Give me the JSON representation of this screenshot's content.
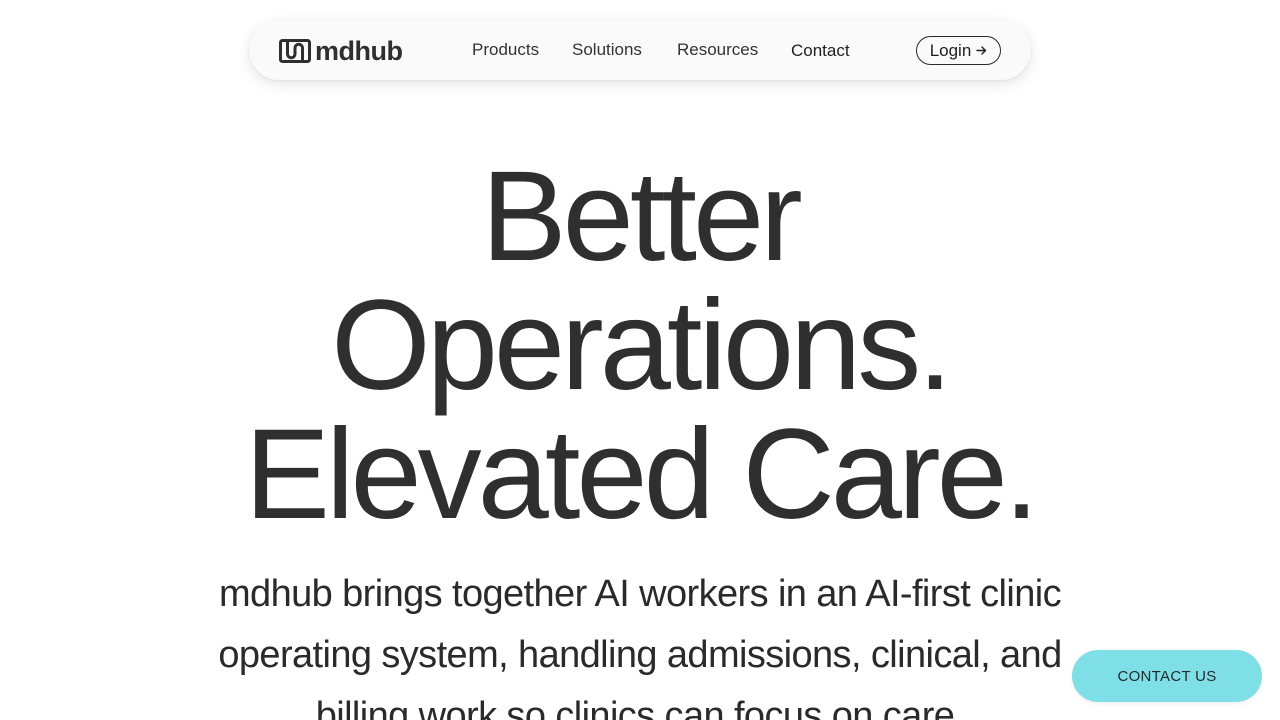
{
  "nav": {
    "logo_text": "mdhub",
    "items": [
      {
        "label": "Products"
      },
      {
        "label": "Solutions"
      },
      {
        "label": "Resources"
      },
      {
        "label": "Contact"
      }
    ],
    "login_label": "Login",
    "login_icon": "arrow-right-icon"
  },
  "hero": {
    "title_lines": [
      "Better",
      "Operations.",
      "Elevated Care."
    ],
    "subtitle": "mdhub brings together AI workers in an AI-first clinic operating system, handling admissions, clinical, and billing work so clinics can focus on care."
  },
  "floating": {
    "contact_label": "CONTACT US"
  },
  "colors": {
    "text": "#2f2f2f",
    "accent": "#7fdfe6",
    "nav_background": "#fafafa"
  }
}
